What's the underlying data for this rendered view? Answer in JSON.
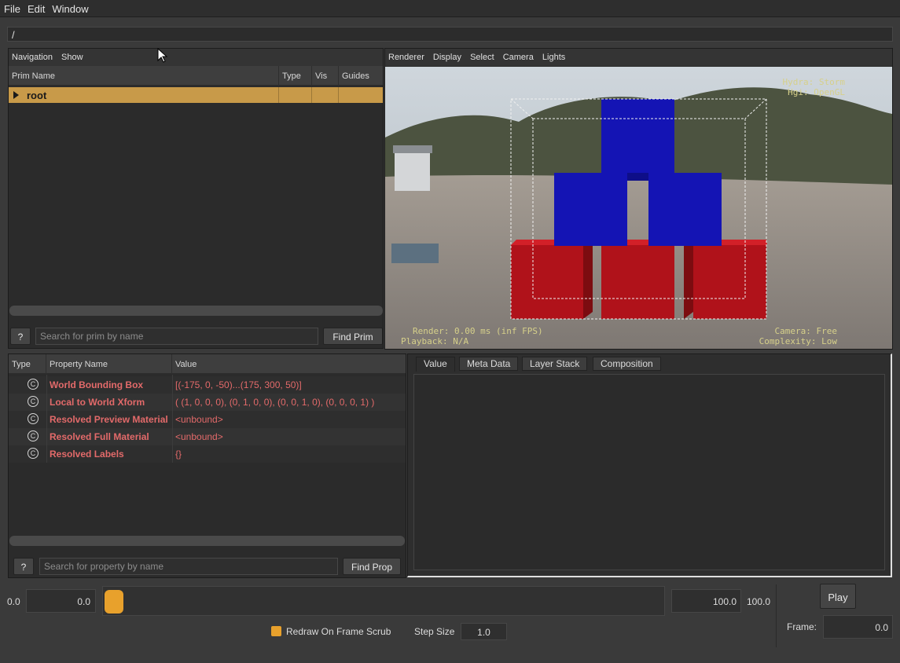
{
  "menubar": [
    "File",
    "Edit",
    "Window"
  ],
  "path_field": "/",
  "navigation": {
    "menu": [
      "Navigation",
      "Show"
    ],
    "columns": [
      "Prim Name",
      "Type",
      "Vis",
      "Guides"
    ],
    "rows": [
      {
        "name": "root",
        "type": "",
        "vis": "",
        "guides": ""
      }
    ],
    "help_label": "?",
    "search_placeholder": "Search for prim by name",
    "find_label": "Find Prim"
  },
  "viewport": {
    "menu": [
      "Renderer",
      "Display",
      "Select",
      "Camera",
      "Lights"
    ],
    "hud_top_right": [
      "Hydra: Storm",
      "Hgi: OpenGL"
    ],
    "hud_bottom_left": [
      "Render: 0.00 ms (inf FPS)",
      "Playback: N/A"
    ],
    "hud_bottom_right": [
      "Camera: Free",
      "Complexity: Low"
    ],
    "colors": {
      "red": "#b0121a",
      "blue": "#1414b4"
    }
  },
  "properties": {
    "columns": [
      "Type",
      "Property Name",
      "Value"
    ],
    "type_glyph": "C",
    "rows": [
      {
        "name": "World Bounding Box",
        "value": "[(-175, 0, -50)...(175, 300, 50)]"
      },
      {
        "name": "Local to World Xform",
        "value": "( (1, 0, 0, 0), (0, 1, 0, 0), (0, 0, 1, 0), (0, 0, 0, 1) )"
      },
      {
        "name": "Resolved Preview Material",
        "value": "<unbound>"
      },
      {
        "name": "Resolved Full Material",
        "value": "<unbound>"
      },
      {
        "name": "Resolved Labels",
        "value": "{}"
      }
    ],
    "help_label": "?",
    "search_placeholder": "Search for property by name",
    "find_label": "Find Prop"
  },
  "inspector": {
    "tabs": [
      "Value",
      "Meta Data",
      "Layer Stack",
      "Composition"
    ]
  },
  "timeline": {
    "start_label": "0.0",
    "start_value": "0.0",
    "end_value": "100.0",
    "end_label": "100.0",
    "slider_fraction": 0.0,
    "play_label": "Play",
    "redraw_label": "Redraw On Frame Scrub",
    "redraw_checked": true,
    "step_size_label": "Step Size",
    "step_size_value": "1.0",
    "frame_label": "Frame:",
    "frame_value": "0.0",
    "accent": "#e8a12c"
  }
}
